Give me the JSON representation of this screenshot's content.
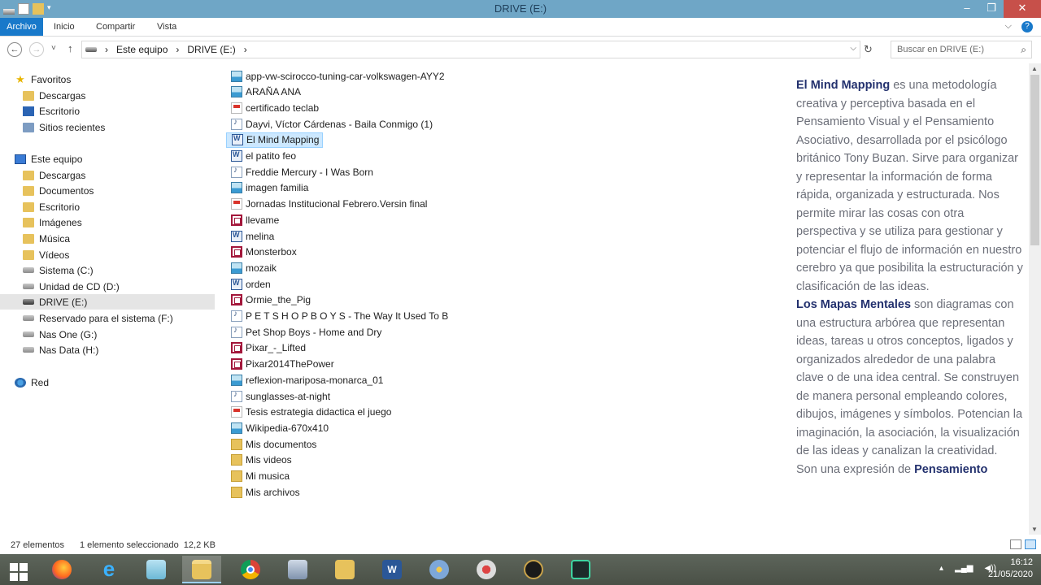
{
  "window": {
    "title": "DRIVE (E:)",
    "min_glyph": "–",
    "max_glyph": "❐",
    "close_glyph": "✕"
  },
  "ribbon": {
    "tabs": [
      "Archivo",
      "Inicio",
      "Compartir",
      "Vista"
    ],
    "expand_glyph": "⌵",
    "help_glyph": "?"
  },
  "address": {
    "crumbs": [
      "Este equipo",
      "DRIVE (E:)"
    ],
    "separator": "›",
    "dropdown_glyph": "⌵",
    "refresh_glyph": "↻",
    "back_glyph": "←",
    "forward_glyph": "→",
    "recent_glyph": "˅",
    "up_glyph": "↑",
    "search_placeholder": "Buscar en DRIVE (E:)",
    "search_glyph": "⌕"
  },
  "nav": {
    "favoritos": "Favoritos",
    "fav_items": [
      "Descargas",
      "Escritorio",
      "Sitios recientes"
    ],
    "este_equipo": "Este equipo",
    "pc_items": [
      "Descargas",
      "Documentos",
      "Escritorio",
      "Imágenes",
      "Música",
      "Vídeos",
      "Sistema (C:)",
      "Unidad de CD (D:)",
      "DRIVE (E:)",
      "Reservado para el sistema (F:)",
      "Nas One (G:)",
      "Nas Data (H:)"
    ],
    "red": "Red",
    "selected": "DRIVE (E:)"
  },
  "files": [
    {
      "name": "app-vw-scirocco-tuning-car-volkswagen-AYY2",
      "icon": "image"
    },
    {
      "name": "ARAÑA ANA",
      "icon": "image"
    },
    {
      "name": "certificado teclab",
      "icon": "pdf"
    },
    {
      "name": "Dayvi, Víctor Cárdenas - Baila Conmigo (1)",
      "icon": "audio"
    },
    {
      "name": "El Mind Mapping",
      "icon": "word",
      "selected": true
    },
    {
      "name": "el patito feo",
      "icon": "word"
    },
    {
      "name": "Freddie Mercury - I Was Born",
      "icon": "audio"
    },
    {
      "name": "imagen familia",
      "icon": "image"
    },
    {
      "name": "Jornadas Institucional Febrero.Versin final",
      "icon": "pdf"
    },
    {
      "name": "llevame",
      "icon": "video"
    },
    {
      "name": "melina",
      "icon": "word"
    },
    {
      "name": "Monsterbox",
      "icon": "video"
    },
    {
      "name": "mozaik",
      "icon": "image"
    },
    {
      "name": "orden",
      "icon": "word"
    },
    {
      "name": "Ormie_the_Pig",
      "icon": "video"
    },
    {
      "name": "P E T S H O P B O Y S - The Way It Used To B",
      "icon": "audio"
    },
    {
      "name": "Pet Shop Boys - Home and Dry",
      "icon": "audio"
    },
    {
      "name": "Pixar_-_Lifted",
      "icon": "video"
    },
    {
      "name": "Pixar2014ThePower",
      "icon": "video"
    },
    {
      "name": "reflexion-mariposa-monarca_01",
      "icon": "image"
    },
    {
      "name": "sunglasses-at-night",
      "icon": "audio"
    },
    {
      "name": "Tesis estrategia didactica el juego",
      "icon": "pdf"
    },
    {
      "name": "Wikipedia-670x410",
      "icon": "image"
    },
    {
      "name": "Mis documentos",
      "icon": "folder"
    },
    {
      "name": "Mis videos",
      "icon": "folder"
    },
    {
      "name": "Mi musica",
      "icon": "folder"
    },
    {
      "name": "Mis archivos",
      "icon": "folder"
    }
  ],
  "preview": {
    "p1_bold": "El Mind Mapping",
    "p1_rest": " es una metodología creativa y perceptiva basada en el Pensamiento Visual y el Pensamiento Asociativo, desarrollada por el psicólogo británico Tony Buzan. Sirve para organizar y representar la información de forma rápida, organizada y estructurada. Nos permite mirar las cosas con otra perspectiva y se utiliza para gestionar y potenciar el flujo de información en nuestro cerebro ya que posibilita la estructuración y clasificación de las ideas.",
    "p2_bold": "Los Mapas Mentales",
    "p2_rest": " son diagramas con una estructura arbórea que representan ideas, tareas u otros conceptos, ligados y organizados alrededor de una palabra clave o de una idea central. Se construyen de manera personal empleando colores, dibujos, imágenes y símbolos. Potencian la imaginación, la asociación, la visualización de las ideas y canalizan la creatividad.",
    "p3_start": "Son una expresión de ",
    "p3_bold": "Pensamiento"
  },
  "status": {
    "count": "27 elementos",
    "selection": "1 elemento seleccionado  12,2 KB"
  },
  "taskbar": {
    "apps": [
      "start-button",
      "firefox-icon",
      "internet-explorer-icon",
      "notepad-icon",
      "file-explorer-icon",
      "chrome-icon",
      "keyboard-icon",
      "folder-key-icon",
      "word-icon",
      "paint-icon",
      "snipping-tool-icon",
      "league-of-legends-icon",
      "filmora-icon"
    ],
    "active": "file-explorer-icon",
    "time": "16:12",
    "date": "21/05/2020",
    "tray_up_glyph": "▴"
  },
  "colors": {
    "titlebar": "#6fa6c6",
    "file_tab": "#1979ca",
    "selection": "#cce8ff",
    "preview_bold": "#23316e",
    "preview_text": "#6c6f79"
  }
}
